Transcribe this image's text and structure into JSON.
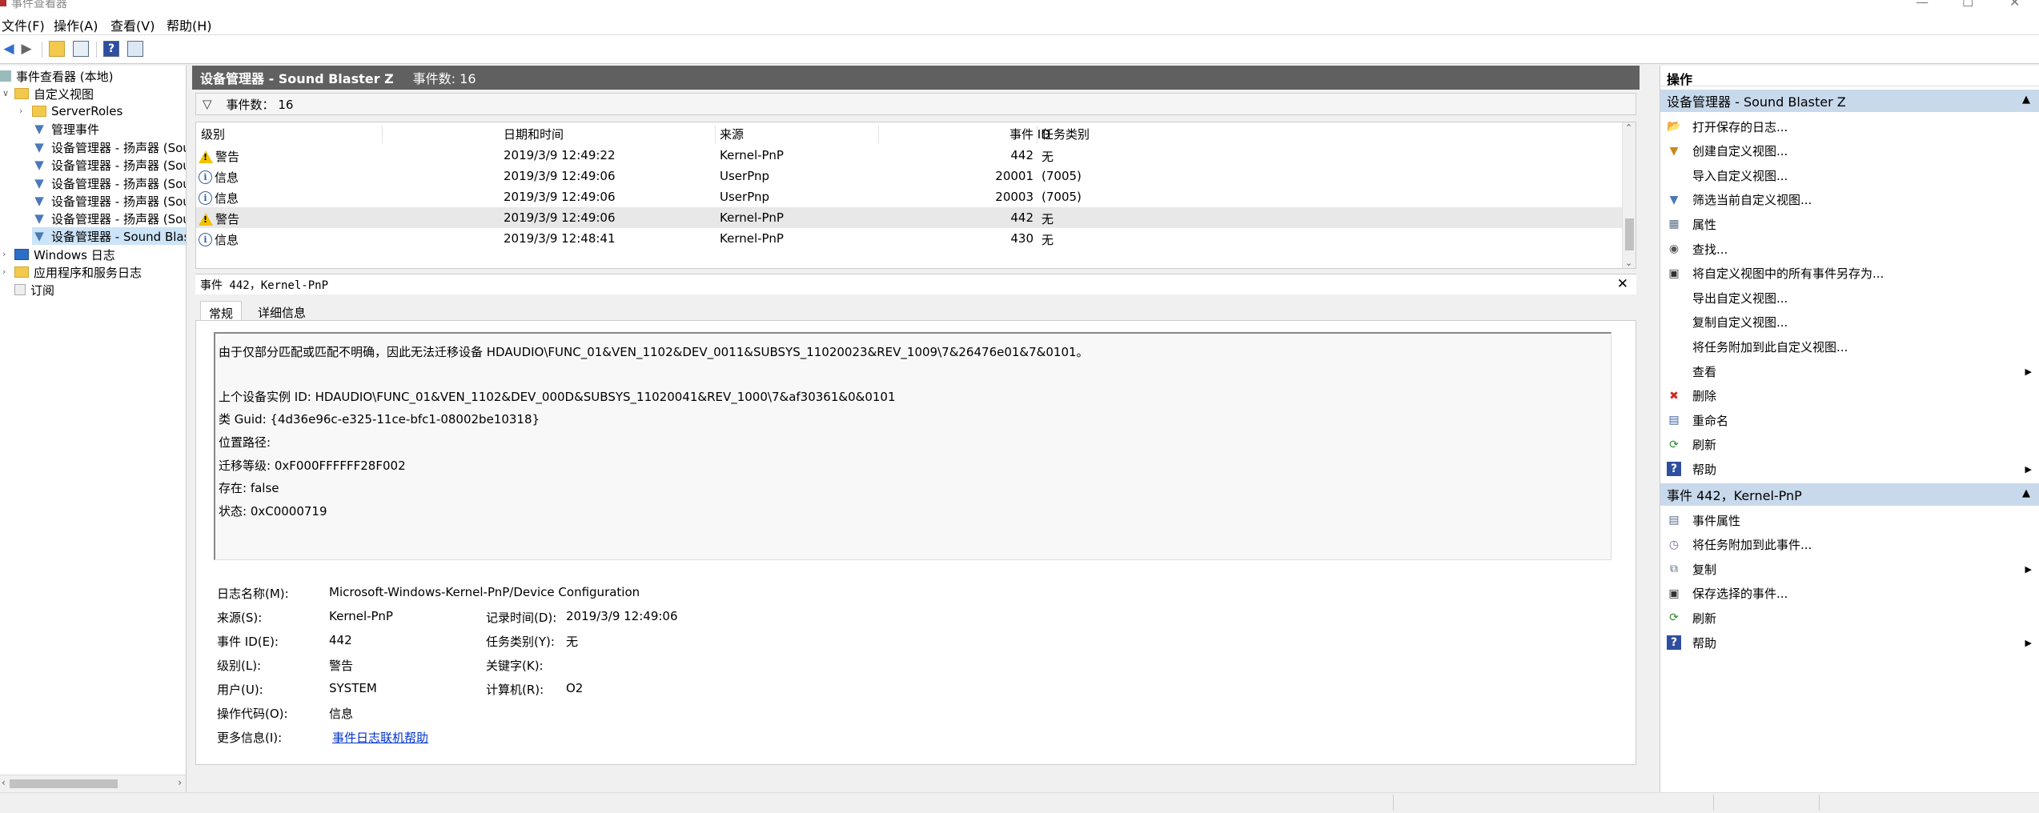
{
  "window": {
    "title": "事件查看器",
    "controls": [
      "—",
      "☐",
      "✕"
    ]
  },
  "menu": [
    "文件(F)",
    "操作(A)",
    "查看(V)",
    "帮助(H)"
  ],
  "toolbar": {
    "help_label": "?"
  },
  "tree": {
    "root": "事件查看器 (本地)",
    "custom_views": "自定义视图",
    "server_roles": "ServerRoles",
    "admin_events": "管理事件",
    "items": [
      "设备管理器 - 扬声器 (Sou",
      "设备管理器 - 扬声器 (Sou",
      "设备管理器 - 扬声器 (Sou",
      "设备管理器 - 扬声器 (Sou",
      "设备管理器 - 扬声器 (Sou",
      "设备管理器 - Sound Blas"
    ],
    "windows_logs": "Windows 日志",
    "app_service_logs": "应用程序和服务日志",
    "subscriptions": "订阅"
  },
  "header": {
    "title": "设备管理器 - Sound Blaster Z",
    "count": "事件数: 16"
  },
  "filter": {
    "label": "事件数： 16"
  },
  "grid": {
    "columns": [
      "级别",
      "日期和时间",
      "来源",
      "事件 ID",
      "任务类别"
    ],
    "rows": [
      {
        "level": "警告",
        "icon": "warning",
        "datetime": "2019/3/9 12:49:22",
        "source": "Kernel-PnP",
        "id": "442",
        "category": "无"
      },
      {
        "level": "信息",
        "icon": "info",
        "datetime": "2019/3/9 12:49:06",
        "source": "UserPnp",
        "id": "20001",
        "category": "(7005)"
      },
      {
        "level": "信息",
        "icon": "info",
        "datetime": "2019/3/9 12:49:06",
        "source": "UserPnp",
        "id": "20003",
        "category": "(7005)"
      },
      {
        "level": "警告",
        "icon": "warning",
        "datetime": "2019/3/9 12:49:06",
        "source": "Kernel-PnP",
        "id": "442",
        "category": "无"
      },
      {
        "level": "信息",
        "icon": "info",
        "datetime": "2019/3/9 12:48:41",
        "source": "Kernel-PnP",
        "id": "430",
        "category": "无"
      }
    ]
  },
  "detail": {
    "title": "事件 442，Kernel-PnP",
    "tabs": [
      "常规",
      "详细信息"
    ],
    "message": [
      "由于仅部分匹配或匹配不明确，因此无法迁移设备 HDAUDIO\\FUNC_01&VEN_1102&DEV_0011&SUBSYS_11020023&REV_1009\\7&26476e01&7&0101。",
      "上个设备实例 ID: HDAUDIO\\FUNC_01&VEN_1102&DEV_000D&SUBSYS_11020041&REV_1000\\7&af30361&0&0101",
      "类 Guid: {4d36e96c-e325-11ce-bfc1-08002be10318}",
      "位置路径:",
      "迁移等级: 0xF000FFFFFF28F002",
      "存在: false",
      "状态: 0xC0000719"
    ],
    "fields": {
      "log_name_label": "日志名称(M):",
      "log_name": "Microsoft-Windows-Kernel-PnP/Device Configuration",
      "source_label": "来源(S):",
      "source": "Kernel-PnP",
      "logged_label": "记录时间(D):",
      "logged": "2019/3/9 12:49:06",
      "event_id_label": "事件 ID(E):",
      "event_id": "442",
      "task_label": "任务类别(Y):",
      "task": "无",
      "level_label": "级别(L):",
      "level": "警告",
      "keywords_label": "关键字(K):",
      "keywords": "",
      "user_label": "用户(U):",
      "user": "SYSTEM",
      "computer_label": "计算机(R):",
      "computer": "O2",
      "opcode_label": "操作代码(O):",
      "opcode": "信息",
      "more_info_label": "更多信息(I):",
      "more_info": "事件日志联机帮助"
    }
  },
  "actions": {
    "title": "操作",
    "section1": "设备管理器 - Sound Blaster Z",
    "items1": [
      {
        "label": "打开保存的日志...",
        "icon": "open-log-icon"
      },
      {
        "label": "创建自定义视图...",
        "icon": "create-view-icon"
      },
      {
        "label": "导入自定义视图...",
        "icon": ""
      },
      {
        "label": "筛选当前自定义视图...",
        "icon": "filter-icon"
      },
      {
        "label": "属性",
        "icon": "properties-icon"
      },
      {
        "label": "查找...",
        "icon": "find-icon"
      },
      {
        "label": "将自定义视图中的所有事件另存为...",
        "icon": "save-icon"
      },
      {
        "label": "导出自定义视图...",
        "icon": ""
      },
      {
        "label": "复制自定义视图...",
        "icon": ""
      },
      {
        "label": "将任务附加到此自定义视图...",
        "icon": ""
      },
      {
        "label": "查看",
        "icon": "",
        "submenu": true
      },
      {
        "label": "删除",
        "icon": "delete-icon"
      },
      {
        "label": "重命名",
        "icon": "rename-icon"
      },
      {
        "label": "刷新",
        "icon": "refresh-icon"
      },
      {
        "label": "帮助",
        "icon": "help-icon",
        "submenu": true
      }
    ],
    "section2": "事件 442，Kernel-PnP",
    "items2": [
      {
        "label": "事件属性",
        "icon": "event-properties-icon"
      },
      {
        "label": "将任务附加到此事件...",
        "icon": "attach-task-icon"
      },
      {
        "label": "复制",
        "icon": "copy-icon",
        "submenu": true
      },
      {
        "label": "保存选择的事件...",
        "icon": "save-icon"
      },
      {
        "label": "刷新",
        "icon": "refresh-icon"
      },
      {
        "label": "帮助",
        "icon": "help-icon",
        "submenu": true
      }
    ]
  }
}
